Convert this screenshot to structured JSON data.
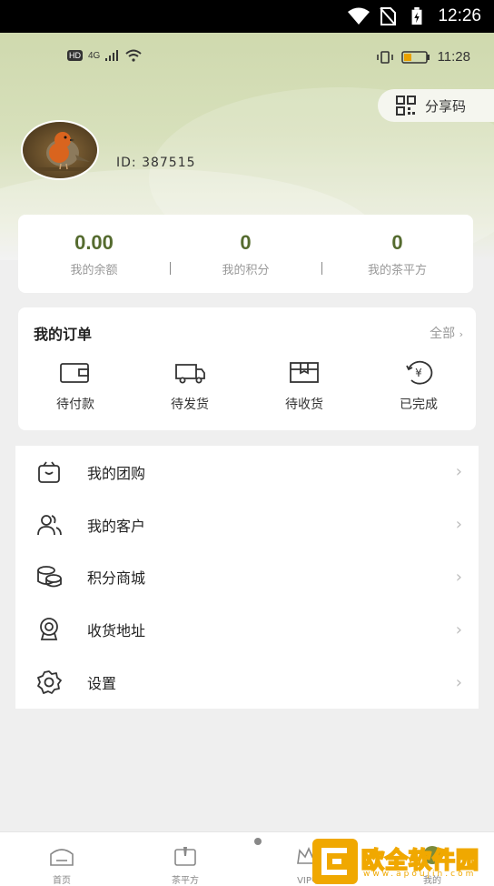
{
  "status_bar": {
    "time": "12:26"
  },
  "inner_status": {
    "hd": "HD",
    "net": "4G",
    "time": "11:28"
  },
  "header": {
    "share_label": "分享码",
    "user_id": "ID: 387515"
  },
  "stats": [
    {
      "value": "0.00",
      "label": "我的余额"
    },
    {
      "value": "0",
      "label": "我的积分"
    },
    {
      "value": "0",
      "label": "我的茶平方"
    }
  ],
  "orders": {
    "title": "我的订单",
    "all_label": "全部",
    "items": [
      {
        "label": "待付款",
        "icon": "wallet-icon"
      },
      {
        "label": "待发货",
        "icon": "truck-icon"
      },
      {
        "label": "待收货",
        "icon": "package-icon"
      },
      {
        "label": "已完成",
        "icon": "yen-coin-icon"
      }
    ]
  },
  "menu": {
    "items": [
      {
        "label": "我的团购",
        "icon": "shopping-bag-icon"
      },
      {
        "label": "我的客户",
        "icon": "users-icon"
      },
      {
        "label": "积分商城",
        "icon": "coins-icon"
      },
      {
        "label": "收货地址",
        "icon": "location-icon"
      },
      {
        "label": "设置",
        "icon": "gear-icon"
      }
    ]
  },
  "bottom_nav": {
    "items": [
      {
        "label": "首页"
      },
      {
        "label": "茶平方"
      },
      {
        "label": "VIP中"
      },
      {
        "label": "我的"
      }
    ]
  },
  "watermark": {
    "text": "欧全软件园",
    "sub": "www.apoujin.com"
  },
  "colors": {
    "accent": "#556b2f",
    "header": "#d7e0bb",
    "watermark": "#f0a800"
  }
}
